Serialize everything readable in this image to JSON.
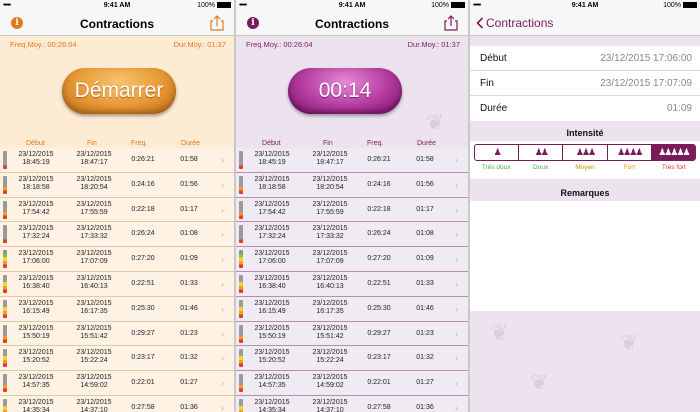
{
  "status": {
    "signal": "••••• ",
    "time": "9:41 AM",
    "battery": "100%"
  },
  "screen1": {
    "title": "Contractions",
    "freq_label": "Freq.Moy.: 00:26:04",
    "dur_label": "Dur.Moy.: 01:37",
    "button_label": "Démarrer",
    "headers": {
      "start": "Début",
      "end": "Fin",
      "freq": "Freq.",
      "dur": "Durée"
    },
    "rows": [
      {
        "start": [
          "23/12/2015",
          "18:45:19"
        ],
        "end": [
          "23/12/2015",
          "18:47:17"
        ],
        "freq": "0:26:21",
        "dur": "01:58",
        "level": 1
      },
      {
        "start": [
          "23/12/2015",
          "18:18:58"
        ],
        "end": [
          "23/12/2015",
          "18:20:54"
        ],
        "freq": "0:24:16",
        "dur": "01:56",
        "level": 2
      },
      {
        "start": [
          "23/12/2015",
          "17:54:42"
        ],
        "end": [
          "23/12/2015",
          "17:55:59"
        ],
        "freq": "0:22:18",
        "dur": "01:17",
        "level": 2
      },
      {
        "start": [
          "23/12/2015",
          "17:32:24"
        ],
        "end": [
          "23/12/2015",
          "17:33:32"
        ],
        "freq": "0:26:24",
        "dur": "01:08",
        "level": 1
      },
      {
        "start": [
          "23/12/2015",
          "17:06:00"
        ],
        "end": [
          "23/12/2015",
          "17:07:09"
        ],
        "freq": "0:27:20",
        "dur": "01:09",
        "level": 5
      },
      {
        "start": [
          "23/12/2015",
          "16:38:40"
        ],
        "end": [
          "23/12/2015",
          "16:40:13"
        ],
        "freq": "0:22:51",
        "dur": "01:33",
        "level": 3
      },
      {
        "start": [
          "23/12/2015",
          "16:15:49"
        ],
        "end": [
          "23/12/2015",
          "16:17:35"
        ],
        "freq": "0:25:30",
        "dur": "01:46",
        "level": 3
      },
      {
        "start": [
          "23/12/2015",
          "15:50:19"
        ],
        "end": [
          "23/12/2015",
          "15:51:42"
        ],
        "freq": "0:29:27",
        "dur": "01:23",
        "level": 2
      },
      {
        "start": [
          "23/12/2015",
          "15:20:52"
        ],
        "end": [
          "23/12/2015",
          "15:22:24"
        ],
        "freq": "0:23:17",
        "dur": "01:32",
        "level": 3
      },
      {
        "start": [
          "23/12/2015",
          "14:57:35"
        ],
        "end": [
          "23/12/2015",
          "14:59:02"
        ],
        "freq": "0:22:01",
        "dur": "01:27",
        "level": 2
      },
      {
        "start": [
          "23/12/2015",
          "14:35:34"
        ],
        "end": [
          "23/12/2015",
          "14:37:10"
        ],
        "freq": "0:27:58",
        "dur": "01:36",
        "level": 3
      }
    ]
  },
  "screen2": {
    "title": "Contractions",
    "freq_label": "Freq.Moy.: 00:26:04",
    "dur_label": "Dur.Moy.: 01:37",
    "button_label": "00:14"
  },
  "screen3": {
    "back_label": "Contractions",
    "fields": [
      {
        "key": "Début",
        "value": "23/12/2015 17:06:00"
      },
      {
        "key": "Fin",
        "value": "23/12/2015 17:07:09"
      },
      {
        "key": "Durée",
        "value": "01:09"
      }
    ],
    "intensity_title": "Intensité",
    "intensity_levels": [
      "Très doux",
      "Doux",
      "Moyen",
      "Fort",
      "Très fort"
    ],
    "intensity_selected": 4,
    "notes_title": "Remarques"
  },
  "colors": {
    "orange_accent": "#e07a1f",
    "purple_accent": "#7a1c5a",
    "level_colors": [
      "#8e8e8e",
      "#7cc240",
      "#f2d32b",
      "#f39a29",
      "#e23b2e"
    ]
  }
}
